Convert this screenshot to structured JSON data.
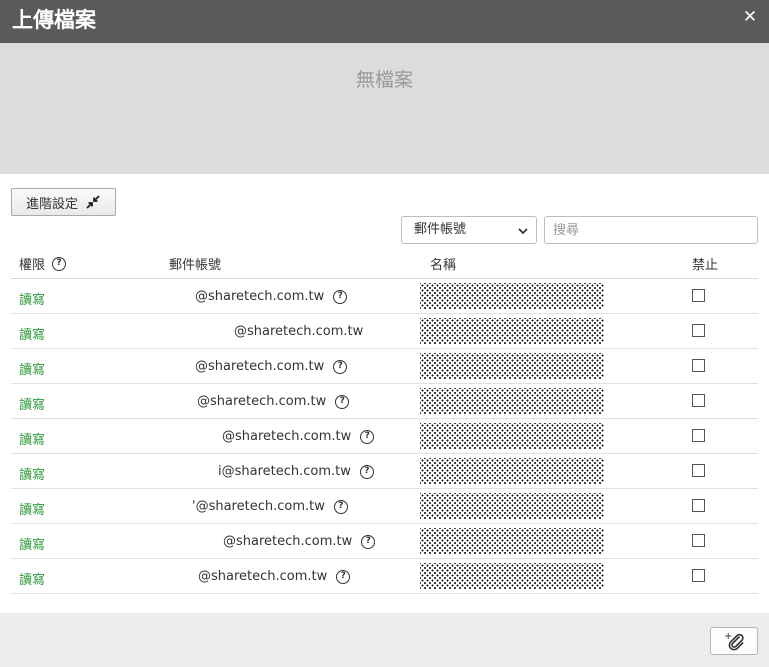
{
  "window": {
    "title": "上傳檔案",
    "close_icon": "close-icon"
  },
  "dropzone": {
    "empty_text": "無檔案"
  },
  "advanced": {
    "label": "進階設定",
    "icon": "collapse-arrows-icon"
  },
  "filter": {
    "selected": "郵件帳號",
    "search_placeholder": "搜尋"
  },
  "table": {
    "headers": {
      "permission": "權限",
      "email": "郵件帳號",
      "name": "名稱",
      "forbid": "禁止"
    },
    "rows": [
      {
        "permission": "讀寫",
        "email": "@sharetech.com.tw",
        "help": true
      },
      {
        "permission": "讀寫",
        "email": "@sharetech.com.tw",
        "help": false
      },
      {
        "permission": "讀寫",
        "email": "@sharetech.com.tw",
        "help": true
      },
      {
        "permission": "讀寫",
        "email": "@sharetech.com.tw",
        "help": true
      },
      {
        "permission": "讀寫",
        "email": "@sharetech.com.tw",
        "help": true
      },
      {
        "permission": "讀寫",
        "email": "i@sharetech.com.tw",
        "help": true
      },
      {
        "permission": "讀寫",
        "email": "'@sharetech.com.tw",
        "help": true
      },
      {
        "permission": "讀寫",
        "email": "@sharetech.com.tw",
        "help": true
      },
      {
        "permission": "讀寫",
        "email": "@sharetech.com.tw",
        "help": true
      }
    ]
  },
  "footer": {
    "attach_icon": "paperclip-add-icon"
  },
  "colors": {
    "titlebar": "#5a5a5a",
    "permission_green": "#2e9a3a",
    "dropzone_bg": "#dcdcdc"
  }
}
